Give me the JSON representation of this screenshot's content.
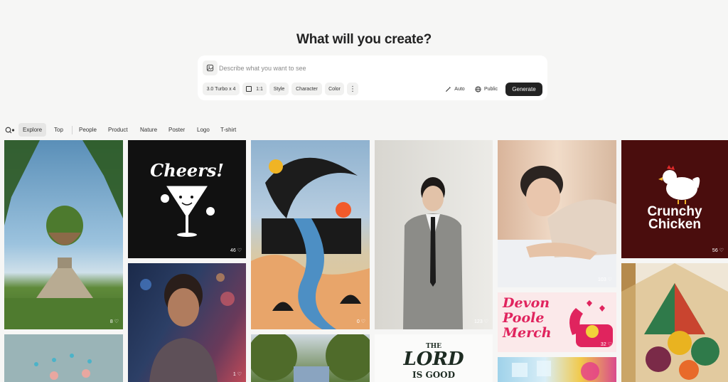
{
  "heading": "What will you create?",
  "prompt": {
    "placeholder": "Describe what you want to see",
    "model": "3.0 Turbo x 4",
    "ratio": "1:1",
    "style": "Style",
    "character": "Character",
    "color": "Color",
    "more": "⋮",
    "auto": "Auto",
    "visibility": "Public",
    "generate": "Generate"
  },
  "tabs": [
    "Explore",
    "Top",
    "People",
    "Product",
    "Nature",
    "Poster",
    "Logo",
    "T-shirt"
  ],
  "cards": {
    "pyramid": {
      "likes": "8"
    },
    "cheers": {
      "text": "Cheers!",
      "likes": "46"
    },
    "portrait_man": {
      "likes": "1"
    },
    "surreal": {
      "likes": "0"
    },
    "suit": {
      "likes": "123"
    },
    "bed": {
      "likes": "103"
    },
    "devon": {
      "text_line1": "Devon",
      "text_line2": "Poole",
      "text_line3": "Merch",
      "likes": "32"
    },
    "crunchy": {
      "text_line1": "Crunchy",
      "text_line2": "Chicken",
      "likes": "56"
    },
    "lord": {
      "text_line1": "THE",
      "text_line2": "LORD",
      "text_line3": "IS GOOD"
    }
  },
  "colors": {
    "accent": "#232323",
    "background": "#f6f6f5",
    "crunchy_bg": "#4a0d0d",
    "devon_pink": "#e0245e"
  }
}
